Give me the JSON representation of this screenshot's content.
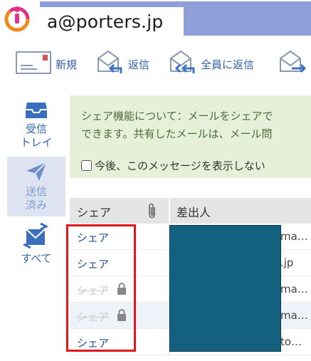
{
  "header": {
    "account": "a@porters.jp",
    "logo_icon": "porters-logo-icon"
  },
  "toolbar": {
    "items": [
      {
        "label": "新規",
        "icon": "new-mail-icon"
      },
      {
        "label": "返信",
        "icon": "reply-icon"
      },
      {
        "label": "全員に返信",
        "icon": "reply-all-icon"
      },
      {
        "label": "",
        "icon": "forward-icon"
      }
    ]
  },
  "nav": {
    "items": [
      {
        "label_line1": "受信",
        "label_line2": "トレイ",
        "icon": "inbox-icon"
      },
      {
        "label_line1": "送信",
        "label_line2": "済み",
        "icon": "sent-icon",
        "active": true
      },
      {
        "label_line1": "すべて",
        "label_line2": "",
        "icon": "all-mail-icon"
      }
    ]
  },
  "info": {
    "line1": "シェア機能について：メールをシェアで",
    "line2": "できます。共有したメールは、メール問",
    "checkbox_label": "今後、このメッセージを表示しない"
  },
  "table": {
    "headers": {
      "share": "シェア",
      "sender": "差出人"
    },
    "rows": [
      {
        "share": "シェア",
        "disabled": false,
        "locked": false,
        "sender": "ma…"
      },
      {
        "share": "シェア",
        "disabled": false,
        "locked": false,
        "sender": ".jp"
      },
      {
        "share": "シェア",
        "disabled": true,
        "locked": true,
        "sender": "ma…"
      },
      {
        "share": "シェア",
        "disabled": true,
        "locked": true,
        "sender": "ma…"
      },
      {
        "share": "シェア",
        "disabled": false,
        "locked": false,
        "sender": "to…"
      }
    ]
  },
  "colors": {
    "header_band": "#8fa0d8",
    "link_blue": "#2d5fa6",
    "info_bg": "#e6f0d9",
    "info_text": "#4d6b38",
    "redaction": "#14607f",
    "highlight": "#e0181e"
  }
}
